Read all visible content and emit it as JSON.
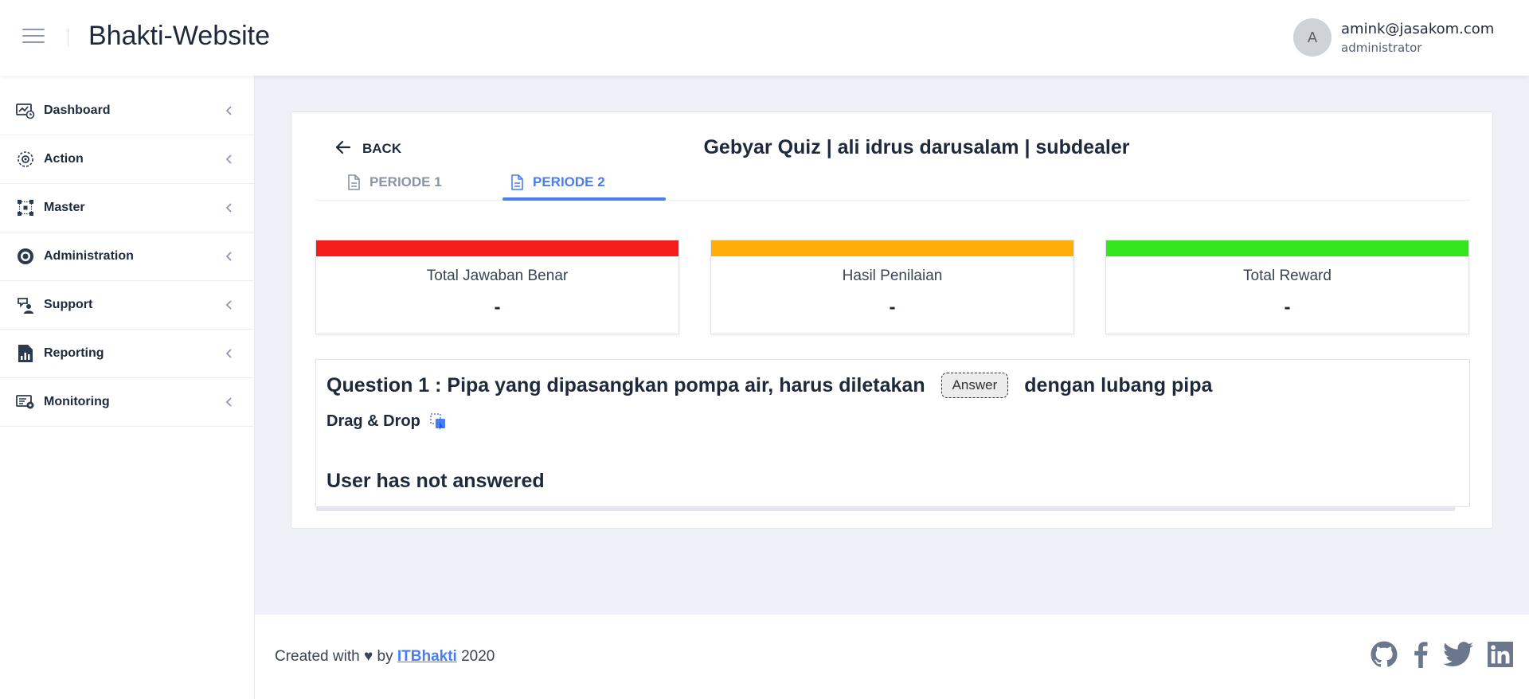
{
  "header": {
    "app_title": "Bhakti-Website",
    "menu_icon": "hamburger-menu-icon",
    "user": {
      "avatar_initial": "A",
      "email": "amink@jasakom.com",
      "role": "administrator"
    }
  },
  "sidebar": {
    "items": [
      {
        "label": "Dashboard",
        "icon": "dashboard-icon"
      },
      {
        "label": "Action",
        "icon": "action-icon"
      },
      {
        "label": "Master",
        "icon": "master-icon"
      },
      {
        "label": "Administration",
        "icon": "administration-gear-icon"
      },
      {
        "label": "Support",
        "icon": "support-icon"
      },
      {
        "label": "Reporting",
        "icon": "reporting-icon"
      },
      {
        "label": "Monitoring",
        "icon": "monitoring-icon"
      }
    ]
  },
  "main": {
    "back_label": "BACK",
    "heading": "Gebyar Quiz | ali idrus darusalam | subdealer",
    "tabs": [
      {
        "label": "PERIODE 1",
        "active": false
      },
      {
        "label": "PERIODE 2",
        "active": true
      }
    ],
    "stats": [
      {
        "label": "Total Jawaban Benar",
        "value": "-",
        "color": "#f51c1c"
      },
      {
        "label": "Hasil Penilaian",
        "value": "-",
        "color": "#ffad08"
      },
      {
        "label": "Total Reward",
        "value": "-",
        "color": "#35e51c"
      }
    ],
    "question": {
      "prefix": "Question 1 : Pipa yang dipasangkan pompa air, harus diletakan",
      "answer_chip": "Answer",
      "suffix": "dengan lubang pipa",
      "type_label": "Drag & Drop",
      "status": "User has not answered"
    }
  },
  "footer": {
    "created_prefix": "Created with ♥ by",
    "link_text": "ITBhakti",
    "year": "2020",
    "socials": [
      "github-icon",
      "facebook-icon",
      "twitter-icon",
      "linkedin-icon"
    ]
  },
  "colors": {
    "accent": "#4a7ef0",
    "text": "#1e2a3b",
    "background": "#eef1f8"
  }
}
